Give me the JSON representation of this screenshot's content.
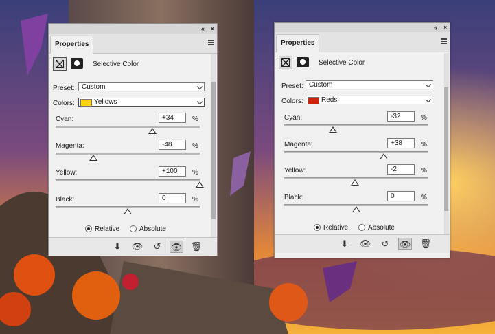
{
  "panels": [
    {
      "tab": "Properties",
      "collapse_glyph": "«",
      "close_glyph": "×",
      "adjustment_title": "Selective Color",
      "preset_label": "Preset:",
      "preset_value": "Custom",
      "colors_label": "Colors:",
      "colors_value": "Yellows",
      "colors_swatch": "#ffd400",
      "sliders": [
        {
          "label": "Cyan:",
          "value": "+34",
          "unit": "%",
          "level": 0.67
        },
        {
          "label": "Magenta:",
          "value": "-48",
          "unit": "%",
          "level": 0.26
        },
        {
          "label": "Yellow:",
          "value": "+100",
          "unit": "%",
          "level": 1.0
        },
        {
          "label": "Black:",
          "value": "0",
          "unit": "%",
          "level": 0.5
        }
      ],
      "method_relative": "Relative",
      "method_absolute": "Absolute",
      "method_selected": "relative"
    },
    {
      "tab": "Properties",
      "collapse_glyph": "«",
      "close_glyph": "×",
      "adjustment_title": "Selective Color",
      "preset_label": "Preset:",
      "preset_value": "Custom",
      "colors_label": "Colors:",
      "colors_value": "Reds",
      "colors_swatch": "#d02010",
      "sliders": [
        {
          "label": "Cyan:",
          "value": "-32",
          "unit": "%",
          "level": 0.34
        },
        {
          "label": "Magenta:",
          "value": "+38",
          "unit": "%",
          "level": 0.69
        },
        {
          "label": "Yellow:",
          "value": "-2",
          "unit": "%",
          "level": 0.49
        },
        {
          "label": "Black:",
          "value": "0",
          "unit": "%",
          "level": 0.5
        }
      ],
      "method_relative": "Relative",
      "method_absolute": "Absolute",
      "method_selected": "relative"
    }
  ],
  "footer_icons": [
    "clip-to-layer-icon",
    "view-previous-icon",
    "reset-icon",
    "visibility-icon",
    "trash-icon"
  ],
  "footer_glyphs": [
    "⬇",
    "👁",
    "↺",
    "👁",
    "🗑"
  ]
}
